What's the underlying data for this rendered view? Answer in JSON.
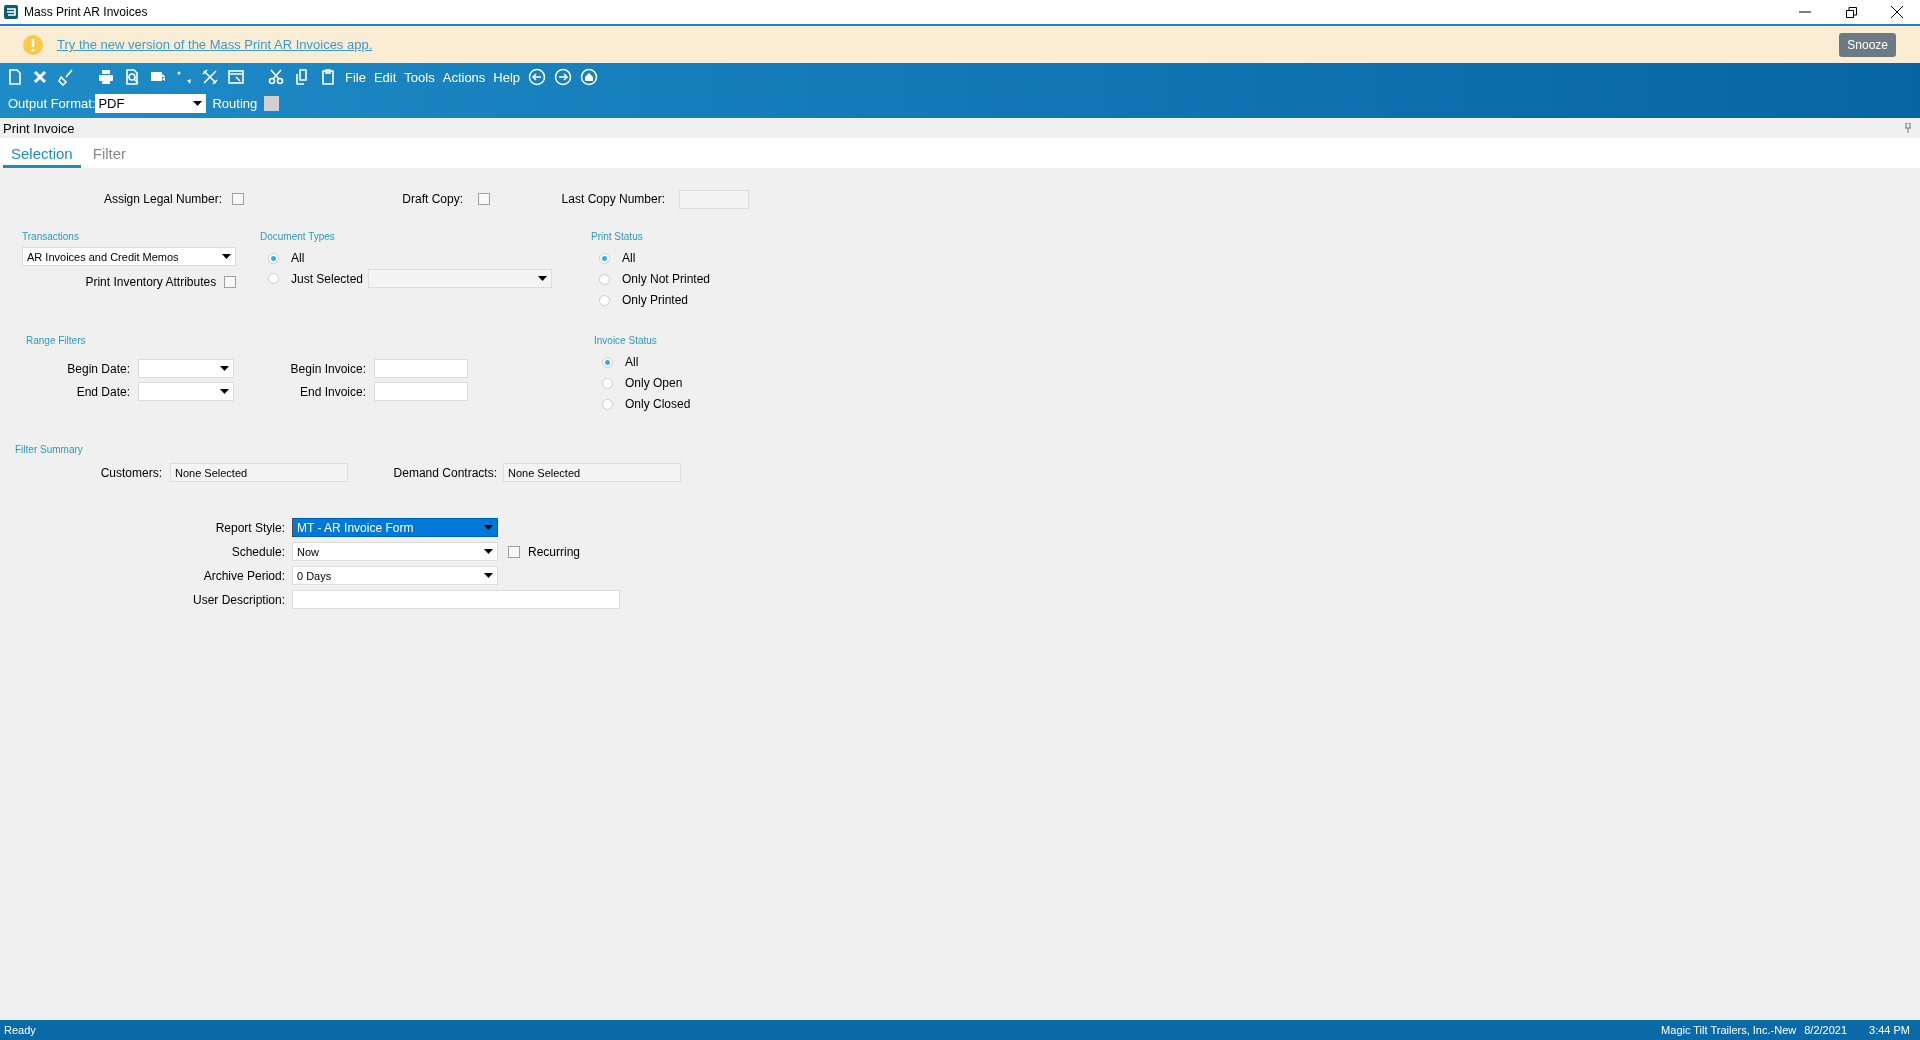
{
  "window": {
    "title": "Mass Print AR Invoices"
  },
  "banner": {
    "link": "Try the new version of the Mass Print AR Invoices app.",
    "button": "Snooze"
  },
  "menus": [
    "File",
    "Edit",
    "Tools",
    "Actions",
    "Help"
  ],
  "output": {
    "label": "Output Format:",
    "value": "PDF",
    "routing_label": "Routing",
    "routing_checked": false
  },
  "panel": {
    "title": "Print Invoice"
  },
  "tabs": [
    {
      "label": "Selection",
      "selected": true
    },
    {
      "label": "Filter",
      "selected": false
    }
  ],
  "assign_legal_number": {
    "label": "Assign Legal Number:",
    "checked": false
  },
  "draft_copy": {
    "label": "Draft Copy:",
    "checked": false
  },
  "last_copy_number": {
    "label": "Last Copy Number:"
  },
  "transactions": {
    "heading": "Transactions",
    "value": "AR Invoices and Credit Memos",
    "attributes_label": "Print Inventory Attributes",
    "attributes_checked": false
  },
  "document_types": {
    "heading": "Document Types",
    "options": [
      {
        "label": "All",
        "selected": true
      },
      {
        "label": "Just Selected",
        "selected": false
      }
    ]
  },
  "print_status": {
    "heading": "Print Status",
    "options": [
      {
        "label": "All",
        "selected": true
      },
      {
        "label": "Only Not Printed",
        "selected": false
      },
      {
        "label": "Only Printed",
        "selected": false
      }
    ]
  },
  "range_filters": {
    "heading": "Range Filters",
    "begin_date": "Begin Date:",
    "end_date": "End Date:",
    "begin_invoice": "Begin Invoice:",
    "end_invoice": "End Invoice:"
  },
  "invoice_status": {
    "heading": "Invoice Status",
    "options": [
      {
        "label": "All",
        "selected": true
      },
      {
        "label": "Only Open",
        "selected": false
      },
      {
        "label": "Only Closed",
        "selected": false
      }
    ]
  },
  "filter_summary": {
    "heading": "Filter Summary",
    "customers_label": "Customers:",
    "customers_value": "None Selected",
    "contracts_label": "Demand Contracts:",
    "contracts_value": "None Selected"
  },
  "report": {
    "style_label": "Report Style:",
    "style_value": "MT - AR Invoice Form",
    "schedule_label": "Schedule:",
    "schedule_value": "Now",
    "recurring_label": "Recurring",
    "recurring_checked": false,
    "archive_label": "Archive Period:",
    "archive_value": "0 Days",
    "description_label": "User Description:"
  },
  "status_bar": {
    "status": "Ready",
    "company": "Magic Tilt Trailers, Inc.-New",
    "date": "8/2/2021",
    "time": "3:44 PM"
  }
}
